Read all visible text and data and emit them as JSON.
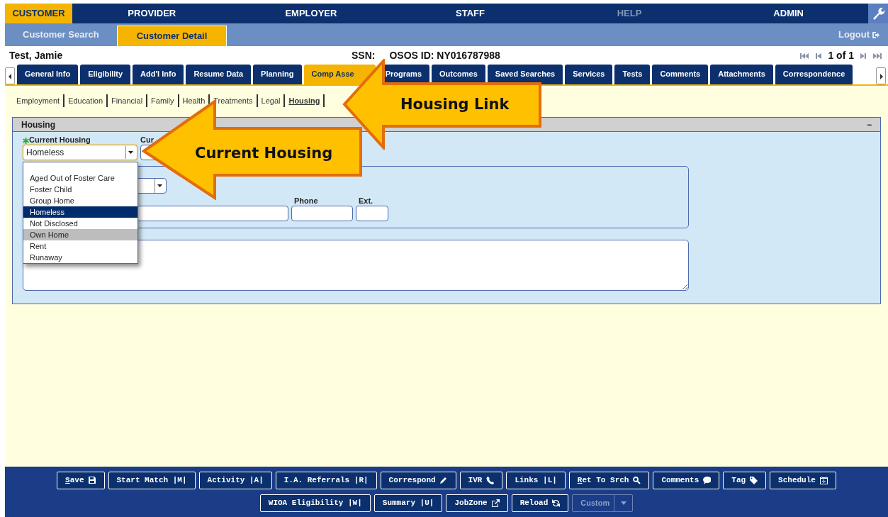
{
  "main_nav": [
    {
      "label": "CUSTOMER",
      "selected": true,
      "disabled": false
    },
    {
      "label": "PROVIDER",
      "selected": false,
      "disabled": false
    },
    {
      "label": "EMPLOYER",
      "selected": false,
      "disabled": false
    },
    {
      "label": "STAFF",
      "selected": false,
      "disabled": false
    },
    {
      "label": "HELP",
      "selected": false,
      "disabled": true
    },
    {
      "label": "ADMIN",
      "selected": false,
      "disabled": false
    }
  ],
  "sub_nav": [
    {
      "label": "Customer Search",
      "selected": false
    },
    {
      "label": "Customer Detail",
      "selected": true
    }
  ],
  "logout": "Logout",
  "customer": {
    "name": "Test, Jamie",
    "ssn_label": "SSN:",
    "osos_id": "OSOS ID: NY016787988",
    "pager": "1 of 1"
  },
  "tabs": [
    {
      "label": "General Info",
      "selected": false
    },
    {
      "label": "Eligibility",
      "selected": false
    },
    {
      "label": "Add'l Info",
      "selected": false
    },
    {
      "label": "Resume Data",
      "selected": false
    },
    {
      "label": "Planning",
      "selected": false
    },
    {
      "label": "Comp Asse",
      "selected": true
    },
    {
      "label": "Programs",
      "selected": false
    },
    {
      "label": "Outcomes",
      "selected": false
    },
    {
      "label": "Saved Searches",
      "selected": false
    },
    {
      "label": "Services",
      "selected": false
    },
    {
      "label": "Tests",
      "selected": false
    },
    {
      "label": "Comments",
      "selected": false
    },
    {
      "label": "Attachments",
      "selected": false
    },
    {
      "label": "Correspondence",
      "selected": false
    }
  ],
  "section_links": [
    {
      "label": "Employment",
      "selected": false
    },
    {
      "label": "Education",
      "selected": false
    },
    {
      "label": "Financial",
      "selected": false
    },
    {
      "label": "Family",
      "selected": false
    },
    {
      "label": "Health",
      "selected": false
    },
    {
      "label": "Treatments",
      "selected": false
    },
    {
      "label": "Legal",
      "selected": false
    },
    {
      "label": "Housing",
      "selected": true
    }
  ],
  "panel": {
    "title": "Housing",
    "collapse": "−",
    "current_housing": {
      "label": "Current Housing",
      "required": true,
      "value": "Homeless"
    },
    "second_label": "Cur",
    "phone_label": "Phone",
    "ext_label": "Ext.",
    "dropdown": [
      {
        "label": "Aged Out of Foster Care",
        "selected": false,
        "hovered": false
      },
      {
        "label": "Foster Child",
        "selected": false,
        "hovered": false
      },
      {
        "label": "Group Home",
        "selected": false,
        "hovered": false
      },
      {
        "label": "Homeless",
        "selected": true,
        "hovered": false
      },
      {
        "label": "Not Disclosed",
        "selected": false,
        "hovered": false
      },
      {
        "label": "Own Home",
        "selected": false,
        "hovered": true
      },
      {
        "label": "Rent",
        "selected": false,
        "hovered": false
      },
      {
        "label": "Runaway",
        "selected": false,
        "hovered": false
      }
    ]
  },
  "callouts": [
    {
      "kind": "link",
      "label": "Housing Link"
    },
    {
      "kind": "field",
      "label": "Current Housing"
    }
  ],
  "footer_rows": [
    [
      {
        "label": "Save",
        "kind": "save",
        "hotkey_first": true,
        "disabled": false
      },
      {
        "label": "Start Match |M|",
        "kind": "plain",
        "hotkey_first": false,
        "disabled": false
      },
      {
        "label": "Activity |A|",
        "kind": "plain",
        "hotkey_first": false,
        "disabled": false
      },
      {
        "label": "I.A. Referrals |R|",
        "kind": "plain",
        "hotkey_first": false,
        "disabled": false
      },
      {
        "label": "Correspond",
        "kind": "pencil",
        "hotkey_first": false,
        "disabled": false
      },
      {
        "label": "IVR",
        "kind": "phone",
        "hotkey_first": false,
        "disabled": false
      },
      {
        "label": "Links |L|",
        "kind": "plain",
        "hotkey_first": false,
        "disabled": false
      },
      {
        "label": "Ret To Srch",
        "kind": "search",
        "hotkey_first": true,
        "disabled": false
      },
      {
        "label": "Comments",
        "kind": "comment",
        "hotkey_first": false,
        "disabled": false
      },
      {
        "label": "Tag",
        "kind": "tag",
        "hotkey_first": false,
        "disabled": false
      },
      {
        "label": "Schedule",
        "kind": "calendar",
        "hotkey_first": false,
        "disabled": false
      }
    ],
    [
      {
        "label": "WIOA Eligibility |W|",
        "kind": "plain",
        "hotkey_first": false,
        "disabled": false
      },
      {
        "label": "Summary |U|",
        "kind": "plain",
        "hotkey_first": false,
        "disabled": false
      },
      {
        "label": "JobZone",
        "kind": "external",
        "hotkey_first": false,
        "disabled": false
      },
      {
        "label": "Reload",
        "kind": "reload",
        "hotkey_first": false,
        "disabled": false
      },
      {
        "label": "Custom",
        "kind": "split",
        "hotkey_first": false,
        "disabled": true
      }
    ]
  ]
}
